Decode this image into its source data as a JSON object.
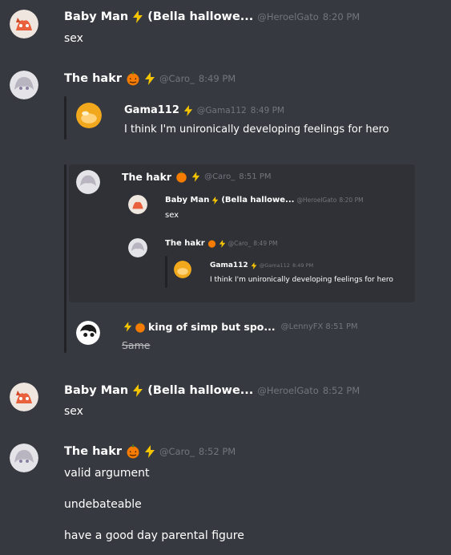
{
  "messages": [
    {
      "user": "Baby Man",
      "badge": "(Bella hallowe...",
      "handle": "@HeroelGato",
      "time": "8:20 PM",
      "text": "sex"
    },
    {
      "user": "The hakr",
      "handle": "@Caro_",
      "time": "8:49 PM",
      "quote": {
        "user": "Gama112",
        "handle": "@Gama112",
        "time": "8:49 PM",
        "text": "I think I'm unironically developing feelings for hero"
      }
    },
    {
      "embed": {
        "user": "The hakr",
        "handle": "@Caro_",
        "time": "8:51 PM",
        "nested": [
          {
            "user": "Baby Man",
            "badge": "(Bella hallowe...",
            "handle": "@HeroelGato",
            "time": "8:20 PM",
            "text": "sex"
          },
          {
            "user": "The hakr",
            "handle": "@Caro_",
            "time": "8:49 PM",
            "quote": {
              "user": "Gama112",
              "handle": "@Gama112",
              "time": "8:49 PM",
              "text": "I think I'm unironically developing feelings for hero"
            }
          }
        ]
      },
      "footer": {
        "user": "king of simp but spo...",
        "handle": "@LennyFX",
        "time": "8:51 PM",
        "text": "Same"
      }
    },
    {
      "user": "Baby Man",
      "badge": "(Bella hallowe...",
      "handle": "@HeroelGato",
      "time": "8:52 PM",
      "text": "sex"
    },
    {
      "user": "The hakr",
      "handle": "@Caro_",
      "time": "8:52 PM",
      "lines": [
        "valid argument",
        "undebateable",
        "have a good day parental figure"
      ]
    }
  ],
  "colors": {
    "background": "#36393f",
    "embed": "#2f3136",
    "username": "#ffffff",
    "meta": "#72767d",
    "lightning": "#f5c400",
    "pumpkin": "#f57c00"
  },
  "icons": [
    "lightning-icon",
    "pumpkin-icon",
    "avatar-fox",
    "avatar-anime",
    "avatar-gold",
    "avatar-bw"
  ]
}
